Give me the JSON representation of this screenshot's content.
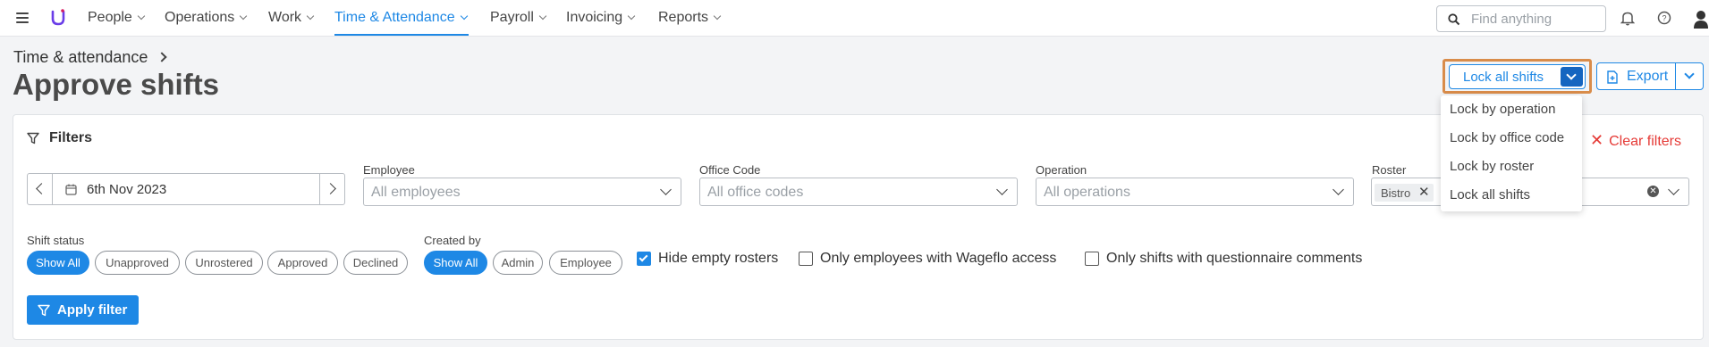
{
  "nav": {
    "items": [
      {
        "label": "People"
      },
      {
        "label": "Operations"
      },
      {
        "label": "Work"
      },
      {
        "label": "Time & Attendance"
      },
      {
        "label": "Payroll"
      },
      {
        "label": "Invoicing"
      },
      {
        "label": "Reports"
      }
    ],
    "active": "Time & Attendance",
    "search_placeholder": "Find anything"
  },
  "header": {
    "breadcrumb": "Time & attendance",
    "title": "Approve shifts"
  },
  "actions": {
    "lock_label": "Lock all shifts",
    "export_label": "Export",
    "menu": [
      "Lock by operation",
      "Lock by office code",
      "Lock by roster",
      "Lock all shifts"
    ]
  },
  "filters": {
    "title": "Filters",
    "clear_label": "Clear filters",
    "date": "6th Nov 2023",
    "employee": {
      "label": "Employee",
      "placeholder": "All employees"
    },
    "office_code": {
      "label": "Office Code",
      "placeholder": "All office codes"
    },
    "operation": {
      "label": "Operation",
      "placeholder": "All operations"
    },
    "roster": {
      "label": "Roster",
      "tag": "Bistro"
    },
    "shift_status": {
      "label": "Shift status",
      "options": [
        "Show All",
        "Unapproved",
        "Unrostered",
        "Approved",
        "Declined"
      ],
      "selected": "Show All"
    },
    "created_by": {
      "label": "Created by",
      "options": [
        "Show All",
        "Admin",
        "Employee"
      ],
      "selected": "Show All"
    },
    "checkboxes": [
      {
        "label": "Hide empty rosters",
        "checked": true
      },
      {
        "label": "Only employees with Wageflo access",
        "checked": false
      },
      {
        "label": "Only shifts with questionnaire comments",
        "checked": false
      }
    ],
    "apply_label": "Apply filter"
  },
  "colors": {
    "accent": "#1e88e5",
    "accent_dark": "#1565c0",
    "danger": "#e53935",
    "highlight": "#d98c4a"
  }
}
